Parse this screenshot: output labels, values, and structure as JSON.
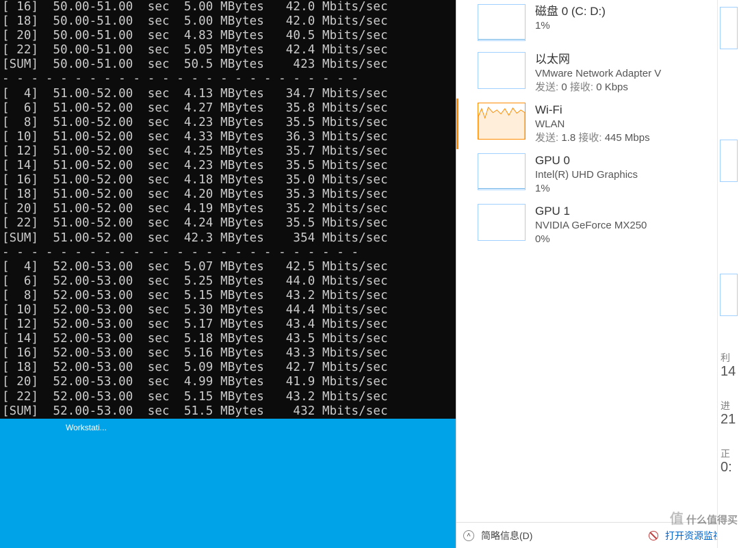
{
  "terminal": {
    "blocks": [
      {
        "rows": [
          {
            "id": " 16",
            "ival": "50.00-51.00",
            "xfer": "5.00 MBytes",
            "bw": " 42.0 Mbits/sec"
          },
          {
            "id": " 18",
            "ival": "50.00-51.00",
            "xfer": "5.00 MBytes",
            "bw": " 42.0 Mbits/sec"
          },
          {
            "id": " 20",
            "ival": "50.00-51.00",
            "xfer": "4.83 MBytes",
            "bw": " 40.5 Mbits/sec"
          },
          {
            "id": " 22",
            "ival": "50.00-51.00",
            "xfer": "5.05 MBytes",
            "bw": " 42.4 Mbits/sec"
          },
          {
            "id": "SUM",
            "ival": "50.00-51.00",
            "xfer": "50.5 MBytes",
            "bw": "  423 Mbits/sec"
          }
        ]
      },
      {
        "rows": [
          {
            "id": "  4",
            "ival": "51.00-52.00",
            "xfer": "4.13 MBytes",
            "bw": " 34.7 Mbits/sec"
          },
          {
            "id": "  6",
            "ival": "51.00-52.00",
            "xfer": "4.27 MBytes",
            "bw": " 35.8 Mbits/sec"
          },
          {
            "id": "  8",
            "ival": "51.00-52.00",
            "xfer": "4.23 MBytes",
            "bw": " 35.5 Mbits/sec"
          },
          {
            "id": " 10",
            "ival": "51.00-52.00",
            "xfer": "4.33 MBytes",
            "bw": " 36.3 Mbits/sec"
          },
          {
            "id": " 12",
            "ival": "51.00-52.00",
            "xfer": "4.25 MBytes",
            "bw": " 35.7 Mbits/sec"
          },
          {
            "id": " 14",
            "ival": "51.00-52.00",
            "xfer": "4.23 MBytes",
            "bw": " 35.5 Mbits/sec"
          },
          {
            "id": " 16",
            "ival": "51.00-52.00",
            "xfer": "4.18 MBytes",
            "bw": " 35.0 Mbits/sec"
          },
          {
            "id": " 18",
            "ival": "51.00-52.00",
            "xfer": "4.20 MBytes",
            "bw": " 35.3 Mbits/sec"
          },
          {
            "id": " 20",
            "ival": "51.00-52.00",
            "xfer": "4.19 MBytes",
            "bw": " 35.2 Mbits/sec"
          },
          {
            "id": " 22",
            "ival": "51.00-52.00",
            "xfer": "4.24 MBytes",
            "bw": " 35.5 Mbits/sec"
          },
          {
            "id": "SUM",
            "ival": "51.00-52.00",
            "xfer": "42.3 MBytes",
            "bw": "  354 Mbits/sec"
          }
        ]
      },
      {
        "rows": [
          {
            "id": "  4",
            "ival": "52.00-53.00",
            "xfer": "5.07 MBytes",
            "bw": " 42.5 Mbits/sec"
          },
          {
            "id": "  6",
            "ival": "52.00-53.00",
            "xfer": "5.25 MBytes",
            "bw": " 44.0 Mbits/sec"
          },
          {
            "id": "  8",
            "ival": "52.00-53.00",
            "xfer": "5.15 MBytes",
            "bw": " 43.2 Mbits/sec"
          },
          {
            "id": " 10",
            "ival": "52.00-53.00",
            "xfer": "5.30 MBytes",
            "bw": " 44.4 Mbits/sec"
          },
          {
            "id": " 12",
            "ival": "52.00-53.00",
            "xfer": "5.17 MBytes",
            "bw": " 43.4 Mbits/sec"
          },
          {
            "id": " 14",
            "ival": "52.00-53.00",
            "xfer": "5.18 MBytes",
            "bw": " 43.5 Mbits/sec"
          },
          {
            "id": " 16",
            "ival": "52.00-53.00",
            "xfer": "5.16 MBytes",
            "bw": " 43.3 Mbits/sec"
          },
          {
            "id": " 18",
            "ival": "52.00-53.00",
            "xfer": "5.09 MBytes",
            "bw": " 42.7 Mbits/sec"
          },
          {
            "id": " 20",
            "ival": "52.00-53.00",
            "xfer": "4.99 MBytes",
            "bw": " 41.9 Mbits/sec"
          },
          {
            "id": " 22",
            "ival": "52.00-53.00",
            "xfer": "5.15 MBytes",
            "bw": " 43.2 Mbits/sec"
          },
          {
            "id": "SUM",
            "ival": "52.00-53.00",
            "xfer": "51.5 MBytes",
            "bw": "  432 Mbits/sec"
          }
        ]
      }
    ],
    "sep": "- - - - - - - - - - - - - - - - - - - - - - - - -"
  },
  "taskbar": {
    "app": "Workstati..."
  },
  "perf": {
    "items": [
      {
        "title": "磁盘 0 (C: D:)",
        "sub": "1%"
      },
      {
        "title": "以太网",
        "sub": "VMware Network Adapter V",
        "sub2_send_lbl": "发送:",
        "sub2_send": "0",
        "sub2_recv_lbl": "接收:",
        "sub2_recv": "0 Kbps"
      },
      {
        "title": "Wi-Fi",
        "sub": "WLAN",
        "sub2_send_lbl": "发送:",
        "sub2_send": "1.8",
        "sub2_recv_lbl": "接收:",
        "sub2_recv": "445 Mbps",
        "selected": true
      },
      {
        "title": "GPU 0",
        "sub": "Intel(R) UHD Graphics",
        "sub2": "1%"
      },
      {
        "title": "GPU 1",
        "sub": "NVIDIA GeForce MX250",
        "sub2": "0%"
      }
    ]
  },
  "mini": {
    "util_lbl": "利",
    "util_val": "14",
    "proc_lbl": "进",
    "proc_val": "21",
    "norm_lbl": "正",
    "norm_val": "0:"
  },
  "bottom": {
    "brief": "简略信息(D)",
    "open": "打开资源监视器"
  },
  "watermark": {
    "t1": "值",
    "t2": "什么值得买"
  }
}
